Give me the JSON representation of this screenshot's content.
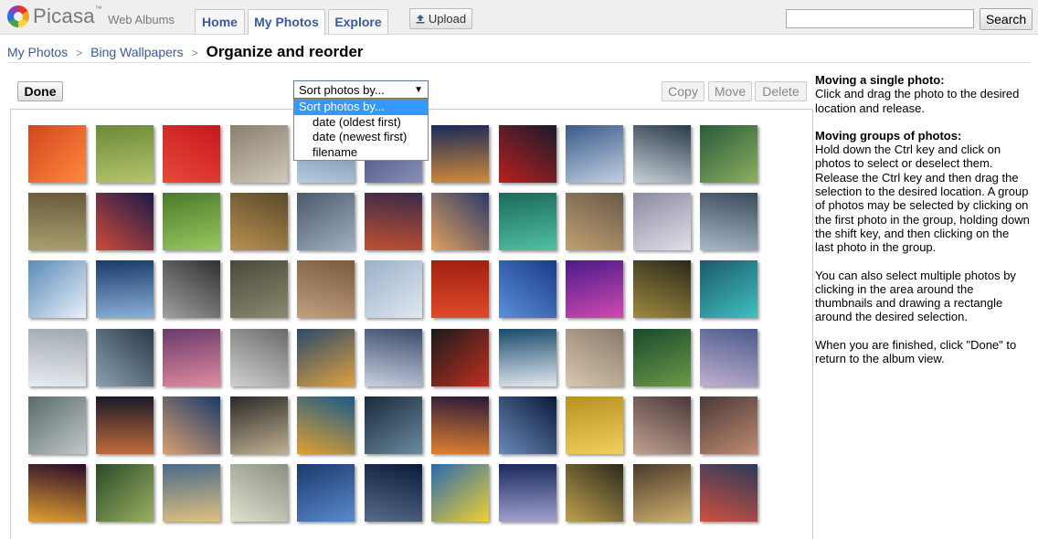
{
  "header": {
    "brand": "Picasa",
    "brand_tm": "™",
    "brand_sub": "Web Albums",
    "tabs": [
      {
        "label": "Home",
        "active": false
      },
      {
        "label": "My Photos",
        "active": true
      },
      {
        "label": "Explore",
        "active": false
      }
    ],
    "upload_label": "Upload",
    "search_value": "",
    "search_button": "Search"
  },
  "breadcrumb": {
    "items": [
      "My Photos",
      "Bing Wallpapers"
    ],
    "separator": ">",
    "current": "Organize and reorder"
  },
  "toolbar": {
    "done_label": "Done",
    "sort_selected": "Sort photos by...",
    "sort_options": [
      "Sort photos by...",
      "date (oldest first)",
      "date (newest first)",
      "filename"
    ],
    "copy_label": "Copy",
    "move_label": "Move",
    "delete_label": "Delete"
  },
  "help": {
    "single_title": "Moving a single photo:",
    "single_text": "Click and drag the photo to the desired location and release.",
    "group_title": "Moving groups of photos:",
    "group_text": "Hold down the Ctrl key and click on photos to select or deselect them. Release the Ctrl key and then drag the selection to the desired location. A group of photos may be selected by clicking on the first photo in the group, holding down the shift key, and then clicking on the last photo in the group.",
    "multi_text": "You can also select multiple photos by clicking in the area around the thumbnails and drawing a rectangle around the desired selection.",
    "done_text": "When you are finished, click \"Done\" to return to the album view."
  },
  "photos": [
    [
      "#d2451e",
      "#ff8a3d"
    ],
    [
      "#6a8a3a",
      "#b5c56a"
    ],
    [
      "#c8161d",
      "#e84a3a"
    ],
    [
      "#8a8070",
      "#d0c8b8"
    ],
    [
      "#5a7a9a",
      "#b8cce0"
    ],
    [
      "#404a7a",
      "#8a90b8"
    ],
    [
      "#1a2a5a",
      "#d08a3a"
    ],
    [
      "#1a1a2a",
      "#b82020"
    ],
    [
      "#3a5a8a",
      "#c0d0e0"
    ],
    [
      "#2a3a4a",
      "#c8d0d8"
    ],
    [
      "#2a5a3a",
      "#8ab060"
    ],
    [
      "#6a5a3a",
      "#a8a070"
    ],
    [
      "#1a1a4a",
      "#d04a3a"
    ],
    [
      "#4a7a2a",
      "#9ac860"
    ],
    [
      "#5a4a2a",
      "#b89050"
    ],
    [
      "#4a5a6a",
      "#a0b0c0"
    ],
    [
      "#3a2a4a",
      "#c05030"
    ],
    [
      "#2a3a6a",
      "#e0a060"
    ],
    [
      "#1a6a5a",
      "#50c0a0"
    ],
    [
      "#6a5a4a",
      "#c0a070"
    ],
    [
      "#8a8aa0",
      "#e0e0ea"
    ],
    [
      "#3a4a5a",
      "#a8b8c8"
    ],
    [
      "#5a8ab8",
      "#e8f0f8"
    ],
    [
      "#1a3a6a",
      "#8ab0d8"
    ],
    [
      "#303030",
      "#a0a0a0"
    ],
    [
      "#4a4a3a",
      "#8a8a70"
    ],
    [
      "#7a5a3a",
      "#c0a080"
    ],
    [
      "#9ab0c8",
      "#e0e8f0"
    ],
    [
      "#a02010",
      "#e04a2a"
    ],
    [
      "#1a3a8a",
      "#5a90d8"
    ],
    [
      "#4a1a8a",
      "#d04ab0"
    ],
    [
      "#2a2a1a",
      "#a08a40"
    ],
    [
      "#1a5a6a",
      "#40c0c0"
    ],
    [
      "#a0a8b0",
      "#e8ecf0"
    ],
    [
      "#2a3a4a",
      "#8aa0b0"
    ],
    [
      "#6a3a6a",
      "#e08aa0"
    ],
    [
      "#6a6a6a",
      "#d0d0d0"
    ],
    [
      "#2a4a6a",
      "#e0a040"
    ],
    [
      "#3a4a6a",
      "#c8d0e0"
    ],
    [
      "#1a1a1a",
      "#c03020"
    ],
    [
      "#1a4a6a",
      "#e0e8f0"
    ],
    [
      "#8a7a6a",
      "#d8c8b0"
    ],
    [
      "#1a4a2a",
      "#6a9a4a"
    ],
    [
      "#4a5a8a",
      "#c0b0d0"
    ],
    [
      "#5a6a6a",
      "#c0c8c8"
    ],
    [
      "#1a1a2a",
      "#c06a3a"
    ],
    [
      "#1a3a6a",
      "#d8a070"
    ],
    [
      "#2a2a2a",
      "#c0b090"
    ],
    [
      "#1a5a8a",
      "#e0a030"
    ],
    [
      "#1a2a3a",
      "#6a8aa0"
    ],
    [
      "#2a1a3a",
      "#e08030"
    ],
    [
      "#0a1a3a",
      "#6a8ab8"
    ],
    [
      "#b89020",
      "#f0d060"
    ],
    [
      "#4a3a3a",
      "#c0a090"
    ],
    [
      "#4a3a3a",
      "#c08a70"
    ],
    [
      "#2a0a2a",
      "#e0a030"
    ],
    [
      "#2a4a2a",
      "#9ab060"
    ],
    [
      "#4a6a8a",
      "#e0c080"
    ],
    [
      "#8a9080",
      "#e0e0d0"
    ],
    [
      "#1a3a6a",
      "#5a8ad0"
    ],
    [
      "#0a1a3a",
      "#5a6a8a"
    ],
    [
      "#2a6ab0",
      "#f0d030"
    ],
    [
      "#1a2a5a",
      "#a0a0d0"
    ],
    [
      "#2a2a1a",
      "#c0a050"
    ],
    [
      "#4a3a2a",
      "#d0b070"
    ],
    [
      "#2a3a5a",
      "#d05040"
    ]
  ]
}
